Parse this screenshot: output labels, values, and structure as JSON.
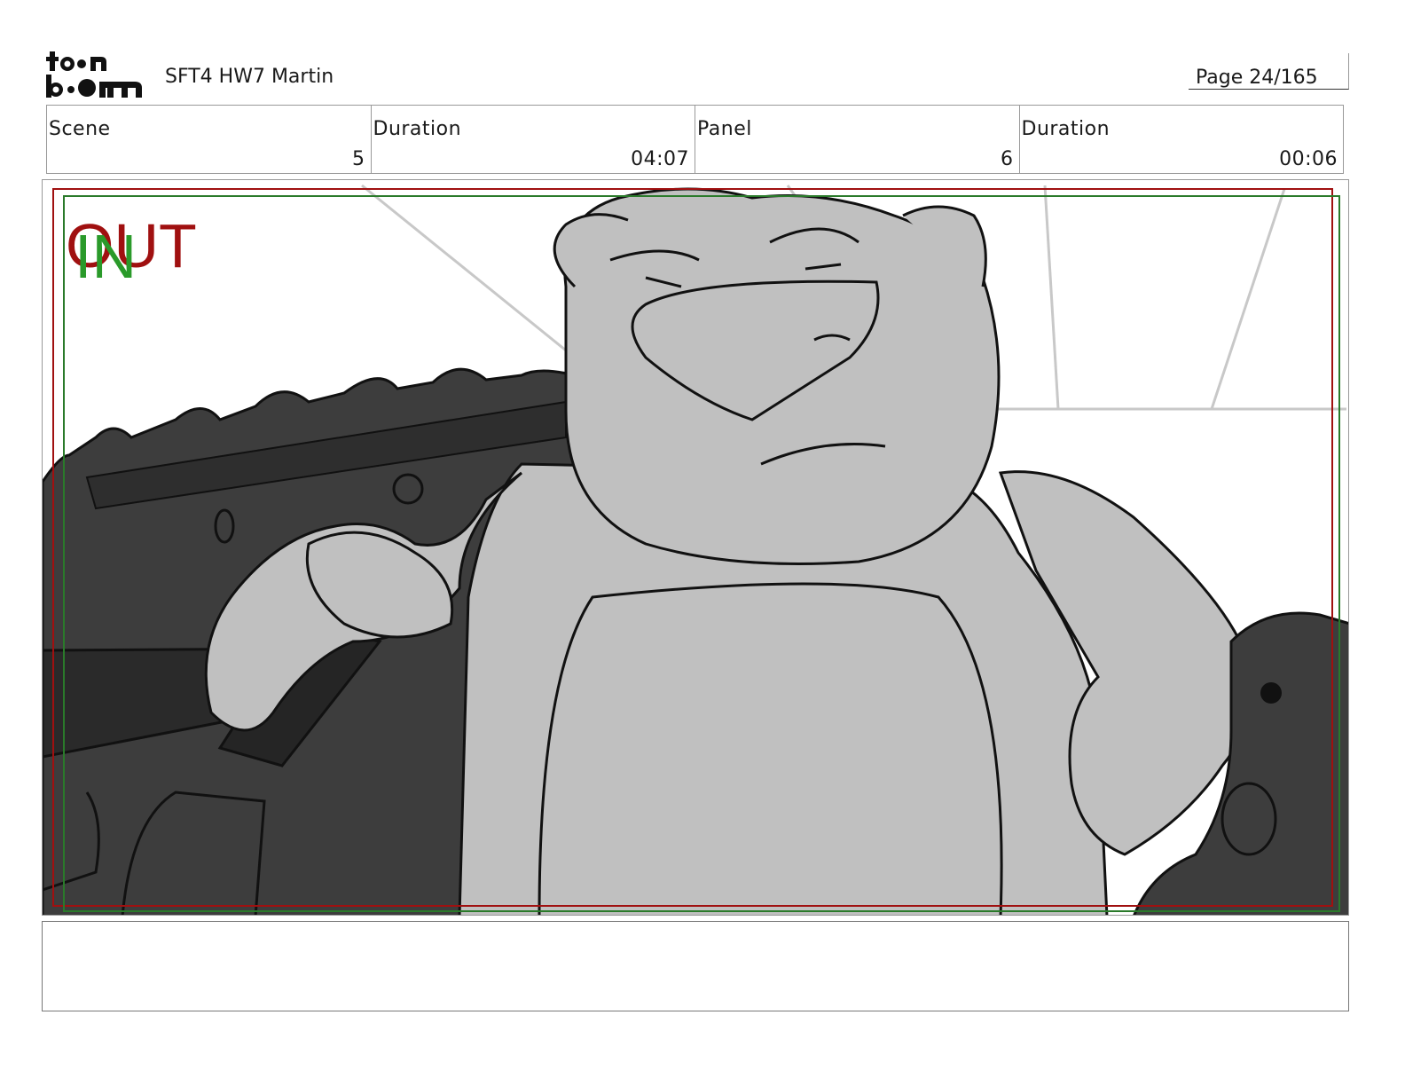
{
  "header": {
    "logo_text": "toon boom",
    "project_title": "SFT4 HW7 Martin",
    "page_label": "Page 24/165"
  },
  "info_table": [
    {
      "label": "Scene",
      "value": "5"
    },
    {
      "label": "Duration",
      "value": "04:07"
    },
    {
      "label": "Panel",
      "value": "6"
    },
    {
      "label": "Duration",
      "value": "00:06"
    }
  ],
  "panel": {
    "safe_area_in_label": "IN",
    "safe_area_out_label": "OUT",
    "colors": {
      "in_green": "#2a9a2a",
      "out_red": "#a01010",
      "bear_fill": "#c0c0c0",
      "dark_fill": "#3d3d3d"
    }
  },
  "notes": {
    "text": ""
  }
}
